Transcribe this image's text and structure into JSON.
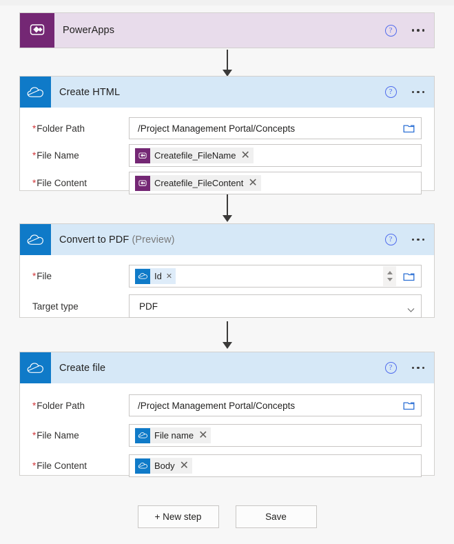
{
  "flow": {
    "steps": [
      {
        "title": "PowerApps",
        "title_suffix": "",
        "icon": "powerapps-icon",
        "theme": "powerapps",
        "help_icon": "help-circle-icon",
        "menu_icon": "ellipsis-icon",
        "fields": []
      },
      {
        "title": "Create HTML",
        "title_suffix": "",
        "icon": "onedrive-cloud-icon",
        "theme": "onedrive",
        "help_icon": "help-circle-icon",
        "menu_icon": "ellipsis-icon",
        "fields": [
          {
            "label": "Folder Path",
            "required": true,
            "kind": "text",
            "value": "/Project Management Portal/Concepts",
            "trailing_icon": "folder-icon"
          },
          {
            "label": "File Name",
            "required": true,
            "kind": "token",
            "token_label": "Createfile_FileName",
            "token_icon": "powerapps-icon",
            "token_theme": "purple",
            "remove_icon": "close-icon"
          },
          {
            "label": "File Content",
            "required": true,
            "kind": "token",
            "token_label": "Createfile_FileContent",
            "token_icon": "powerapps-icon",
            "token_theme": "purple",
            "remove_icon": "close-icon"
          }
        ]
      },
      {
        "title": "Convert to PDF",
        "title_suffix": "(Preview)",
        "icon": "onedrive-cloud-icon",
        "theme": "onedrive",
        "help_icon": "help-circle-icon",
        "menu_icon": "ellipsis-icon",
        "fields": [
          {
            "label": "File",
            "required": true,
            "kind": "token-spinner",
            "token_label": "Id",
            "token_icon": "onedrive-cloud-icon",
            "token_theme": "blue",
            "remove_icon": "close-icon",
            "spinner_icon": "spinner-arrows-icon",
            "trailing_icon": "folder-icon"
          },
          {
            "label": "Target type",
            "required": false,
            "kind": "dropdown",
            "value": "PDF",
            "trailing_icon": "chevron-down-icon"
          }
        ]
      },
      {
        "title": "Create file",
        "title_suffix": "",
        "icon": "onedrive-cloud-icon",
        "theme": "onedrive",
        "help_icon": "help-circle-icon",
        "menu_icon": "ellipsis-icon",
        "fields": [
          {
            "label": "Folder Path",
            "required": true,
            "kind": "text",
            "value": "/Project Management Portal/Concepts",
            "trailing_icon": "folder-icon"
          },
          {
            "label": "File Name",
            "required": true,
            "kind": "token",
            "token_label": "File name",
            "token_icon": "onedrive-cloud-icon",
            "token_theme": "blue",
            "remove_icon": "close-icon"
          },
          {
            "label": "File Content",
            "required": true,
            "kind": "token",
            "token_label": "Body",
            "token_icon": "onedrive-cloud-icon",
            "token_theme": "blue",
            "remove_icon": "close-icon"
          }
        ]
      }
    ]
  },
  "actions": {
    "new_step_label": "+ New step",
    "save_label": "Save"
  },
  "colors": {
    "powerapps_purple": "#742774",
    "onedrive_blue": "#0f7ac8",
    "powerapps_header_bg": "#e8dceb",
    "onedrive_header_bg": "#d6e8f7",
    "required_red": "#d13438",
    "help_blue": "#4f6bed",
    "canvas_bg": "#f7f7f7"
  }
}
